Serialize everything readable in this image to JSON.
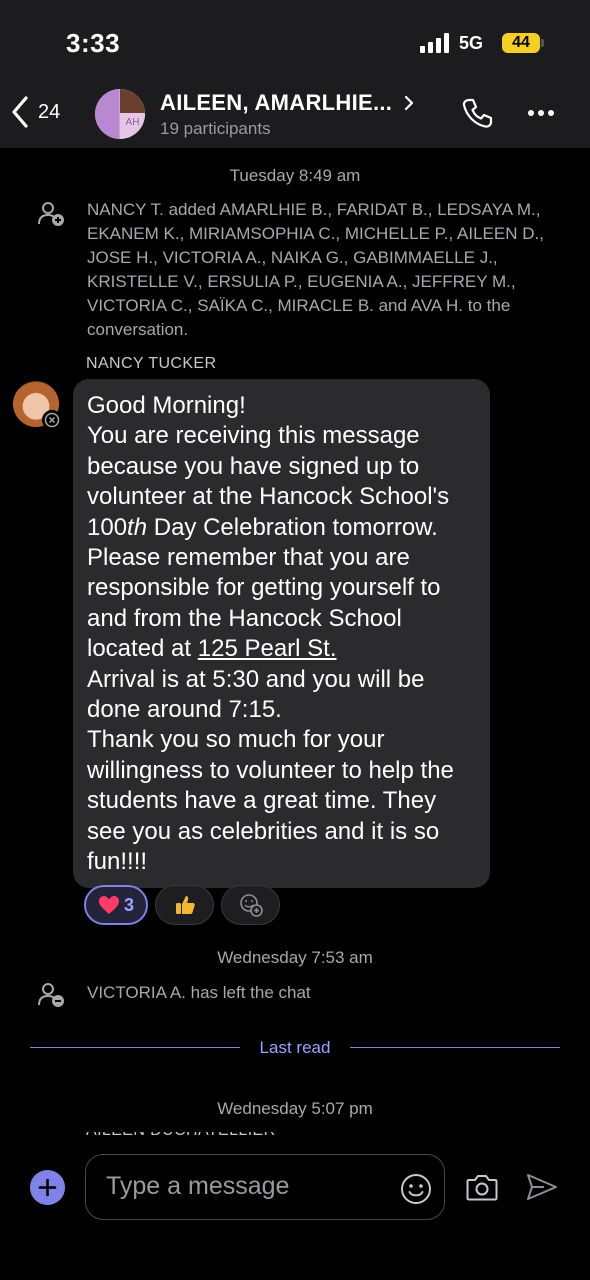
{
  "status_bar": {
    "time": "3:33",
    "network": "5G",
    "battery": "44",
    "battery_color": "#f5cf24"
  },
  "header": {
    "back_count": "24",
    "avatar_initials": "AH",
    "title": "AILEEN, AMARLHIE...",
    "participants": "19 participants",
    "icons": [
      "chevron-left-icon",
      "chevron-right-icon",
      "phone-icon",
      "more-icon"
    ]
  },
  "chat": {
    "date_1": "Tuesday 8:49 am",
    "system_added": "NANCY T. added AMARLHIE B., FARIDAT B., LEDSAYA M., EKANEM K., MIRIAMSOPHIA C., MICHELLE P., AILEEN D., JOSE H., VICTORIA A., NAIKA G., GABIMMAELLE J., KRISTELLE V., ERSULIA P., EUGENIA A., JEFFREY M., VICTORIA C., SAÏKA C., MIRACLE B. and AVA H. to the conversation.",
    "sender": "NANCY TUCKER",
    "message": {
      "line_1": "Good Morning!",
      "line_2": "You are receiving this message because you have signed up to volunteer at the Hancock School's",
      "num": "100",
      "ordinal": "th",
      "line_3_rest": " Day Celebration tomorrow. Please remember that you are responsible for getting yourself to and from the Hancock School located at ",
      "address": "125 Pearl St.",
      "line_4": "Arrival is at 5:30 and you will be done around 7:15.",
      "line_5": "Thank you so much for your willingness to volunteer to help the students have a great time. They see you as celebrities and it is so fun!!!!"
    },
    "reactions": {
      "heart_count": "3",
      "heart_icon": "heart-icon",
      "thumbs_icon": "thumbs-up-icon",
      "add_icon": "add-reaction-icon"
    },
    "date_2": "Wednesday 7:53 am",
    "system_left": "VICTORIA A. has left the chat",
    "last_read": "Last read",
    "date_3": "Wednesday 5:07 pm",
    "partial_sender": "AILEEN DUCHATELLIER"
  },
  "composer": {
    "placeholder": "Type a message",
    "icons": [
      "add-icon",
      "emoji-icon",
      "camera-icon",
      "send-icon"
    ]
  },
  "colors": {
    "accent": "#7f82e6",
    "bubble": "#2b2b2e",
    "header_bg": "#1c1c1e"
  }
}
